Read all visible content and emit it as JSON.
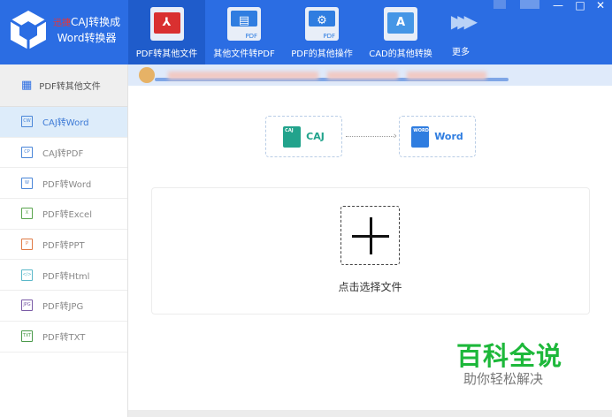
{
  "app": {
    "brand_mark": "迅捷",
    "title_line1": "CAJ转换成",
    "title_line2": "Word转换器"
  },
  "toolbar": {
    "tabs": [
      {
        "label": "PDF转其他文件",
        "icon": "pdf-acrobat-icon",
        "active": true
      },
      {
        "label": "其他文件转PDF",
        "icon": "document-to-pdf-icon",
        "badge": "PDF"
      },
      {
        "label": "PDF的其他操作",
        "icon": "pdf-gears-icon",
        "badge": "PDF"
      },
      {
        "label": "CAD的其他转换",
        "icon": "cad-icon",
        "badge": "A"
      },
      {
        "label": "更多",
        "icon": "more-arrows-icon"
      }
    ]
  },
  "window": {
    "minimize": "—",
    "maximize": "□",
    "close": "✕"
  },
  "sidebar": {
    "header": "PDF转其他文件",
    "items": [
      {
        "label": "CAJ转Word",
        "icon": "CW",
        "color": "#4a86d8",
        "active": true
      },
      {
        "label": "CAJ转PDF",
        "icon": "CP",
        "color": "#4a86d8"
      },
      {
        "label": "PDF转Word",
        "icon": "W",
        "color": "#4a86d8"
      },
      {
        "label": "PDF转Excel",
        "icon": "X",
        "color": "#5aa54e"
      },
      {
        "label": "PDF转PPT",
        "icon": "P",
        "color": "#e07a45"
      },
      {
        "label": "PDF转Html",
        "icon": "</>",
        "color": "#5bb8c9"
      },
      {
        "label": "PDF转JPG",
        "icon": "JPG",
        "color": "#7a5ba6"
      },
      {
        "label": "PDF转TXT",
        "icon": "TXT",
        "color": "#4a9a4a"
      }
    ]
  },
  "conversion": {
    "from": "CAJ",
    "from_doc": "CAJ",
    "from_color": "#22a38c",
    "to": "Word",
    "to_doc": "WORD",
    "to_color": "#2f7de0"
  },
  "upload": {
    "label": "点击选择文件"
  },
  "watermark": {
    "title": "百科全说",
    "subtitle": "助你轻松解决"
  }
}
